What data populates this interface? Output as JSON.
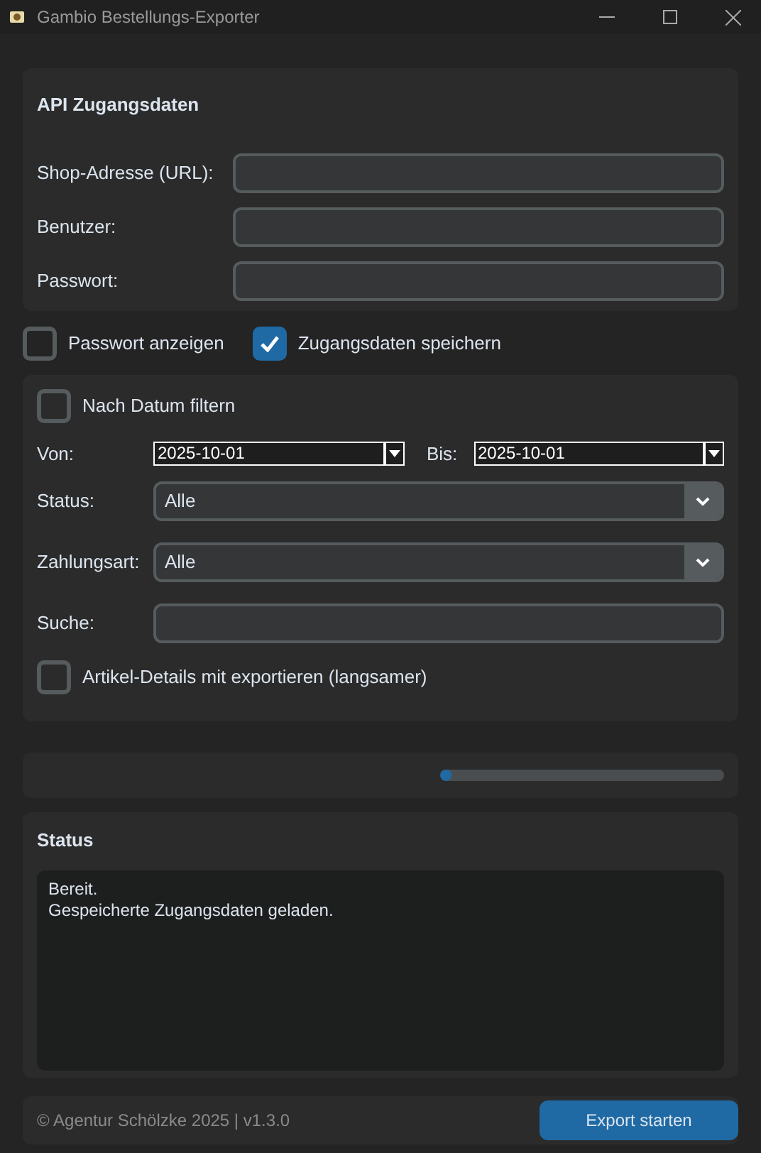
{
  "window": {
    "title": "Gambio Bestellungs-Exporter"
  },
  "credentials": {
    "title": "API Zugangsdaten",
    "fields": [
      {
        "label": "Shop-Adresse (URL):"
      },
      {
        "label": "Benutzer:"
      },
      {
        "label": "Passwort:"
      }
    ]
  },
  "options": [
    {
      "label": "Passwort anzeigen",
      "checked": false
    },
    {
      "label": "Zugangsdaten speichern",
      "checked": true
    }
  ],
  "filters": {
    "date_filter": {
      "label": "Nach Datum filtern",
      "checked": false
    },
    "from": {
      "label": "Von:",
      "value": "2025-10-01"
    },
    "to": {
      "label": "Bis:",
      "value": "2025-10-01"
    },
    "rows": [
      {
        "kind": "select",
        "label": "Status:",
        "value": "Alle"
      },
      {
        "kind": "select",
        "label": "Zahlungsart:",
        "value": "Alle"
      },
      {
        "kind": "text",
        "label": "Suche:"
      }
    ],
    "details": {
      "label": "Artikel-Details mit exportieren (langsamer)",
      "checked": false
    }
  },
  "progress": {
    "level": 0.02
  },
  "status": {
    "title": "Status",
    "lines": [
      "Bereit.",
      "Gespeicherte Zugangsdaten geladen."
    ]
  },
  "footer": {
    "text": "© Agentur Schölzke 2025 | v1.3.0",
    "button": "Export starten"
  }
}
